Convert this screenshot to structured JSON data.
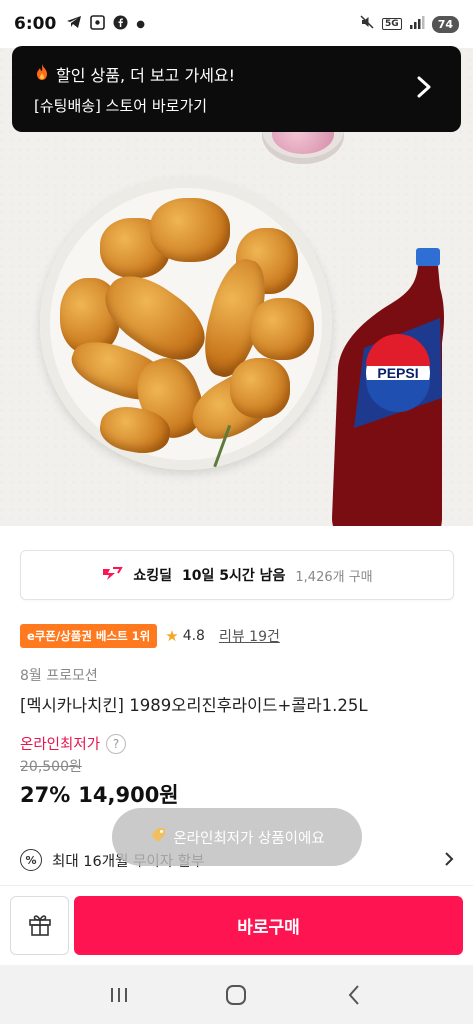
{
  "status_bar": {
    "time": "6:00",
    "network": "5G",
    "battery": "74"
  },
  "banner": {
    "line1": "할인 상품, 더 보고 가세요!",
    "line2": "[슈팅배송] 스토어 바로가기"
  },
  "deal": {
    "label": "쇼킹딜",
    "remaining": "10일 5시간 남음",
    "purchases": "1,426개 구매"
  },
  "product": {
    "badge": "e쿠폰/상품권 베스트 1위",
    "rating": "4.8",
    "reviews": "리뷰 19건",
    "promo": "8월 프로모션",
    "title": "[멕시카나치킨] 1989오리진후라이드+콜라1.25L",
    "lowest_label": "온라인최저가",
    "original_price": "20,500원",
    "discount": "27%",
    "price": "14,900원"
  },
  "toast": {
    "text": "온라인최저가 상품이에요"
  },
  "installment": {
    "text": "최대 16개월 무이자 할부"
  },
  "bottom": {
    "buy_label": "바로구매"
  },
  "hero_image": {
    "bottle_label": "PEPSI"
  },
  "colors": {
    "accent": "#ff1452",
    "price_red": "#e8154f",
    "badge_orange": "#ff7a1f",
    "banner_bg": "#0c0c0c"
  },
  "icons": [
    "telegram-icon",
    "screenshot-icon",
    "facebook-icon",
    "mute-icon",
    "signal-icon",
    "fire-icon",
    "chevron-right-icon",
    "deal-icon",
    "star-icon",
    "question-icon",
    "percent-icon",
    "tag-icon",
    "gift-icon",
    "recent-apps-icon",
    "home-icon",
    "back-icon"
  ]
}
